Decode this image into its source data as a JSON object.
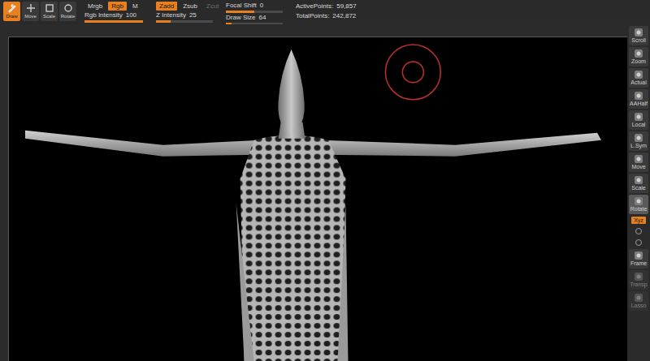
{
  "toolbar": {
    "tools": [
      {
        "label": "Draw",
        "selected": true
      },
      {
        "label": "Move",
        "selected": false
      },
      {
        "label": "Scale",
        "selected": false
      },
      {
        "label": "Rotate",
        "selected": false
      }
    ],
    "color_modes": [
      {
        "label": "Mrgb",
        "selected": false
      },
      {
        "label": "Rgb",
        "selected": true
      },
      {
        "label": "M",
        "selected": false
      }
    ],
    "z_modes": [
      {
        "label": "Zadd",
        "selected": true,
        "disabled": false
      },
      {
        "label": "Zsub",
        "selected": false,
        "disabled": false
      },
      {
        "label": "Zcut",
        "selected": false,
        "disabled": true
      }
    ],
    "rgb_intensity": {
      "label": "Rgb Intensity",
      "value": "100",
      "level": 1.0
    },
    "z_intensity": {
      "label": "Z Intensity",
      "value": "25",
      "level": 0.25
    },
    "focal_shift": {
      "label": "Focal Shift",
      "value": "0",
      "level": 0.5
    },
    "draw_size": {
      "label": "Draw Size",
      "value": "64",
      "level": 0.1
    },
    "stats": [
      {
        "label": "ActivePoints:",
        "value": "59,857"
      },
      {
        "label": "TotalPoints:",
        "value": "242,872"
      }
    ]
  },
  "shelf": [
    {
      "kind": "button",
      "label": "Scroll",
      "selected": false,
      "disabled": false
    },
    {
      "kind": "button",
      "label": "Zoom",
      "selected": false,
      "disabled": false
    },
    {
      "kind": "button",
      "label": "Actual",
      "selected": false,
      "disabled": false
    },
    {
      "kind": "button",
      "label": "AAHalf",
      "selected": false,
      "disabled": false
    },
    {
      "kind": "button",
      "label": "Local",
      "selected": false,
      "disabled": false
    },
    {
      "kind": "button",
      "label": "L.Sym",
      "selected": false,
      "disabled": false
    },
    {
      "kind": "button",
      "label": "Move",
      "selected": false,
      "disabled": false
    },
    {
      "kind": "button",
      "label": "Scale",
      "selected": false,
      "disabled": false
    },
    {
      "kind": "button",
      "label": "Rotate",
      "selected": true,
      "disabled": false
    },
    {
      "kind": "toggle",
      "label": "Xyz",
      "selected": true,
      "disabled": false
    },
    {
      "kind": "icon",
      "label": "",
      "selected": false,
      "disabled": false
    },
    {
      "kind": "icon",
      "label": "",
      "selected": false,
      "disabled": false
    },
    {
      "kind": "button",
      "label": "Frame",
      "selected": false,
      "disabled": false
    },
    {
      "kind": "button",
      "label": "Transp",
      "selected": false,
      "disabled": true
    },
    {
      "kind": "button",
      "label": "Lasso",
      "selected": false,
      "disabled": true
    }
  ]
}
